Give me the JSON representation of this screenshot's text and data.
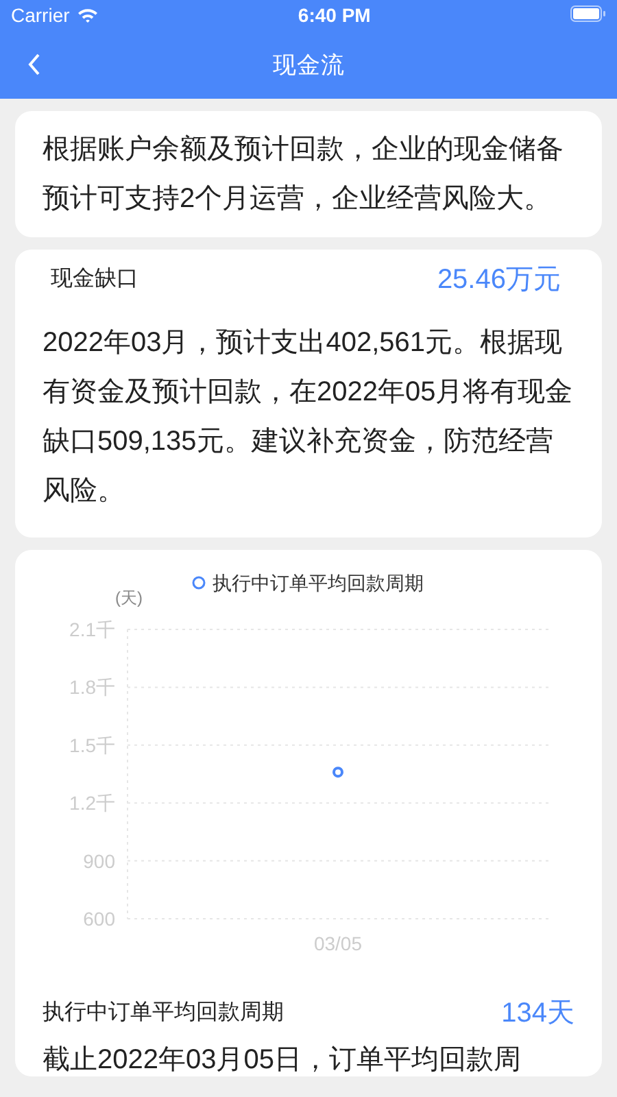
{
  "status_bar": {
    "carrier": "Carrier",
    "time": "6:40 PM"
  },
  "nav": {
    "title": "现金流"
  },
  "summary": "根据账户余额及预计回款，企业的现金储备预计可支持2个月运营，企业经营风险大。",
  "gap_card": {
    "label": "现金缺口",
    "value": "25.46万元",
    "text": "2022年03月，预计支出402,561元。根据现有资金及预计回款，在2022年05月将有现金缺口509,135元。建议补充资金，防范经营风险。"
  },
  "chart_card": {
    "chart_data": {
      "type": "scatter",
      "ylabel": "(天)",
      "categories": [
        "03/05"
      ],
      "series": [
        {
          "name": "执行中订单平均回款周期",
          "color": "#4a87fa",
          "values": [
            1360
          ]
        }
      ],
      "ylim": [
        600,
        2100
      ],
      "grid": true,
      "yticks": [
        600,
        900
      ]
    },
    "y_axis_labels": [
      "2.1千",
      "1.8千",
      "1.5千",
      "1.2千"
    ],
    "label": "执行中订单平均回款周期",
    "value": "134天",
    "text": "截止2022年03月05日，订单平均回款周"
  }
}
